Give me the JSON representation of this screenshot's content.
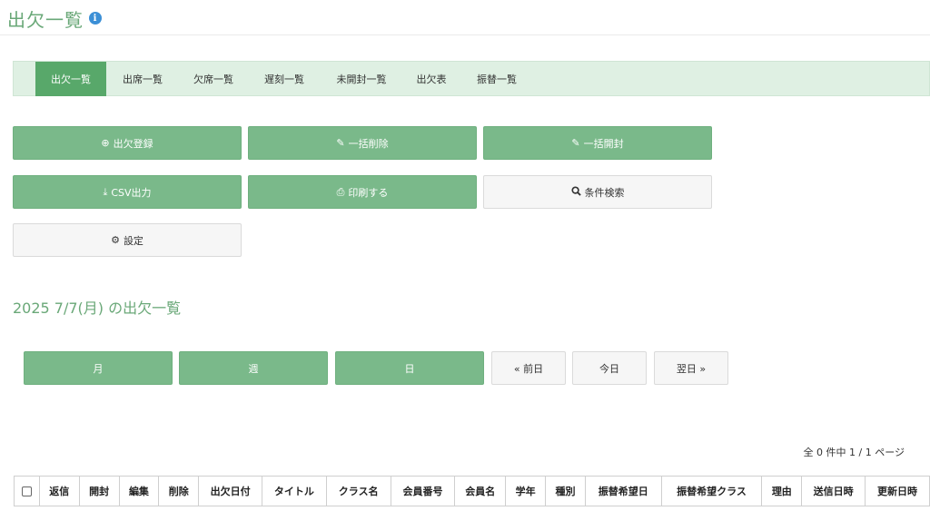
{
  "page": {
    "title": "出欠一覧",
    "info_icon": "i",
    "accent_color": "#6aa878"
  },
  "tabs": [
    {
      "label": "出欠一覧",
      "active": true
    },
    {
      "label": "出席一覧"
    },
    {
      "label": "欠席一覧"
    },
    {
      "label": "遅刻一覧"
    },
    {
      "label": "未開封一覧"
    },
    {
      "label": "出欠表"
    },
    {
      "label": "振替一覧"
    }
  ],
  "actions": {
    "register": {
      "label": "出欠登録",
      "icon": "plus-circle-icon"
    },
    "bulk_delete": {
      "label": "一括削除",
      "icon": "pencil-icon"
    },
    "bulk_open": {
      "label": "一括開封",
      "icon": "pencil-icon"
    },
    "csv": {
      "label": "CSV出力",
      "icon": "download-icon"
    },
    "print": {
      "label": "印刷する",
      "icon": "print-icon"
    },
    "search": {
      "label": "条件検索",
      "icon": "search-icon"
    },
    "settings": {
      "label": "設定",
      "icon": "gear-icon"
    }
  },
  "date_heading": "2025 7/7(月) の出欠一覧",
  "views": {
    "month": "月",
    "week": "週",
    "day": "日",
    "prev": "« 前日",
    "today": "今日",
    "next": "翌日 »"
  },
  "pager": "全 0 件中 1 / 1 ページ",
  "table": {
    "headers": [
      "返信",
      "開封",
      "編集",
      "削除",
      "出欠日付",
      "タイトル",
      "クラス名",
      "会員番号",
      "会員名",
      "学年",
      "種別",
      "振替希望日",
      "振替希望クラス",
      "理由",
      "送信日時",
      "更新日時"
    ]
  }
}
